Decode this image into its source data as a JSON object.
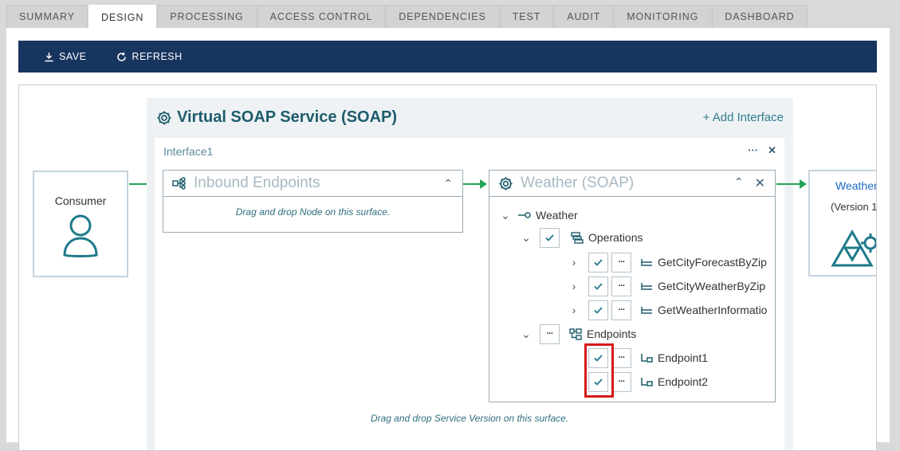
{
  "tabs": [
    "SUMMARY",
    "DESIGN",
    "PROCESSING",
    "ACCESS CONTROL",
    "DEPENDENCIES",
    "TEST",
    "AUDIT",
    "MONITORING",
    "DASHBOARD"
  ],
  "active_tab": "DESIGN",
  "toolbar": {
    "save_label": "SAVE",
    "refresh_label": "REFRESH"
  },
  "consumer": {
    "label": "Consumer"
  },
  "service": {
    "title": "Virtual SOAP Service (SOAP)",
    "add_interface": "+ Add Interface",
    "interface_name": "Interface1",
    "inbound": {
      "title": "Inbound Endpoints",
      "drop_note": "Drag and drop Node on this surface."
    },
    "weather": {
      "title": "Weather (SOAP)",
      "tree": {
        "root": "Weather",
        "operations_label": "Operations",
        "operations": [
          "GetCityForecastByZip",
          "GetCityWeatherByZip",
          "GetWeatherInformatio"
        ],
        "endpoints_label": "Endpoints",
        "endpoints": [
          "Endpoint1",
          "Endpoint2"
        ]
      }
    },
    "drop_service_note": "Drag and drop Service Version on this surface."
  },
  "backend": {
    "link": "Weather",
    "version": "(Version 1"
  },
  "colors": {
    "toolbar": "#18355f",
    "teal": "#1e5c6b",
    "arrow": "#22a35a",
    "highlight": "#d61a1a"
  }
}
